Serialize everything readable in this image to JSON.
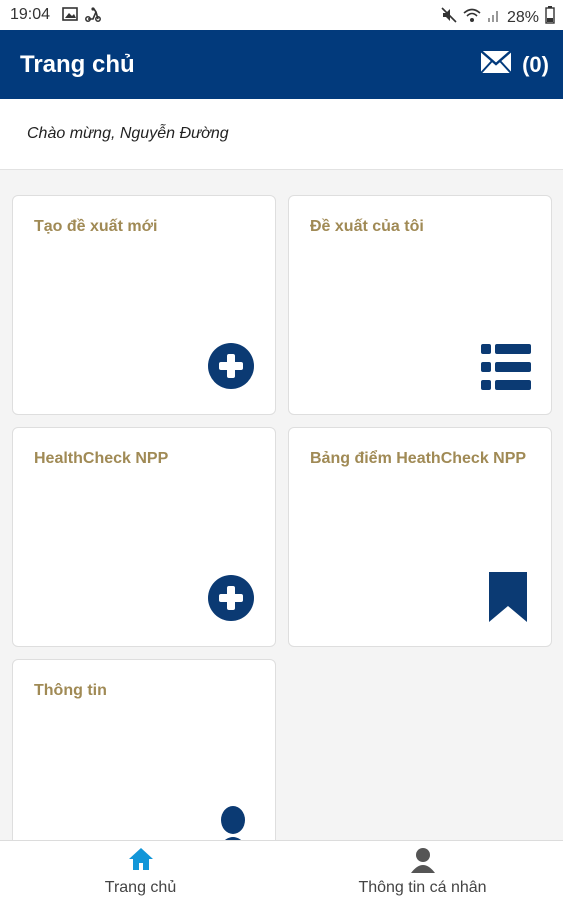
{
  "status_bar": {
    "time": "19:04",
    "battery": "28%",
    "icons": [
      "image-icon",
      "scooter-icon",
      "mute-icon",
      "wifi-icon",
      "signal-icon",
      "battery-icon"
    ]
  },
  "header": {
    "title": "Trang chủ",
    "mail_count": "(0)"
  },
  "welcome": {
    "text": "Chào mừng, Nguyễn Đường"
  },
  "tiles": [
    {
      "label": "Tạo đề xuất mới",
      "icon": "plus-circle-icon"
    },
    {
      "label": "Đề xuất của tôi",
      "icon": "list-icon"
    },
    {
      "label": "HealthCheck NPP",
      "icon": "plus-circle-icon"
    },
    {
      "label": "Bảng điểm HeathCheck NPP",
      "icon": "bookmark-icon"
    },
    {
      "label": "Thông tin",
      "icon": "person-icon"
    }
  ],
  "bottom_nav": [
    {
      "label": "Trang chủ",
      "icon": "home-icon",
      "active": true
    },
    {
      "label": "Thông tin cá nhân",
      "icon": "person-icon",
      "active": false
    }
  ],
  "colors": {
    "header_bg": "#023a7c",
    "tile_label": "#a08a55",
    "icon": "#0b3a73",
    "active_nav_icon": "#1296d8"
  }
}
